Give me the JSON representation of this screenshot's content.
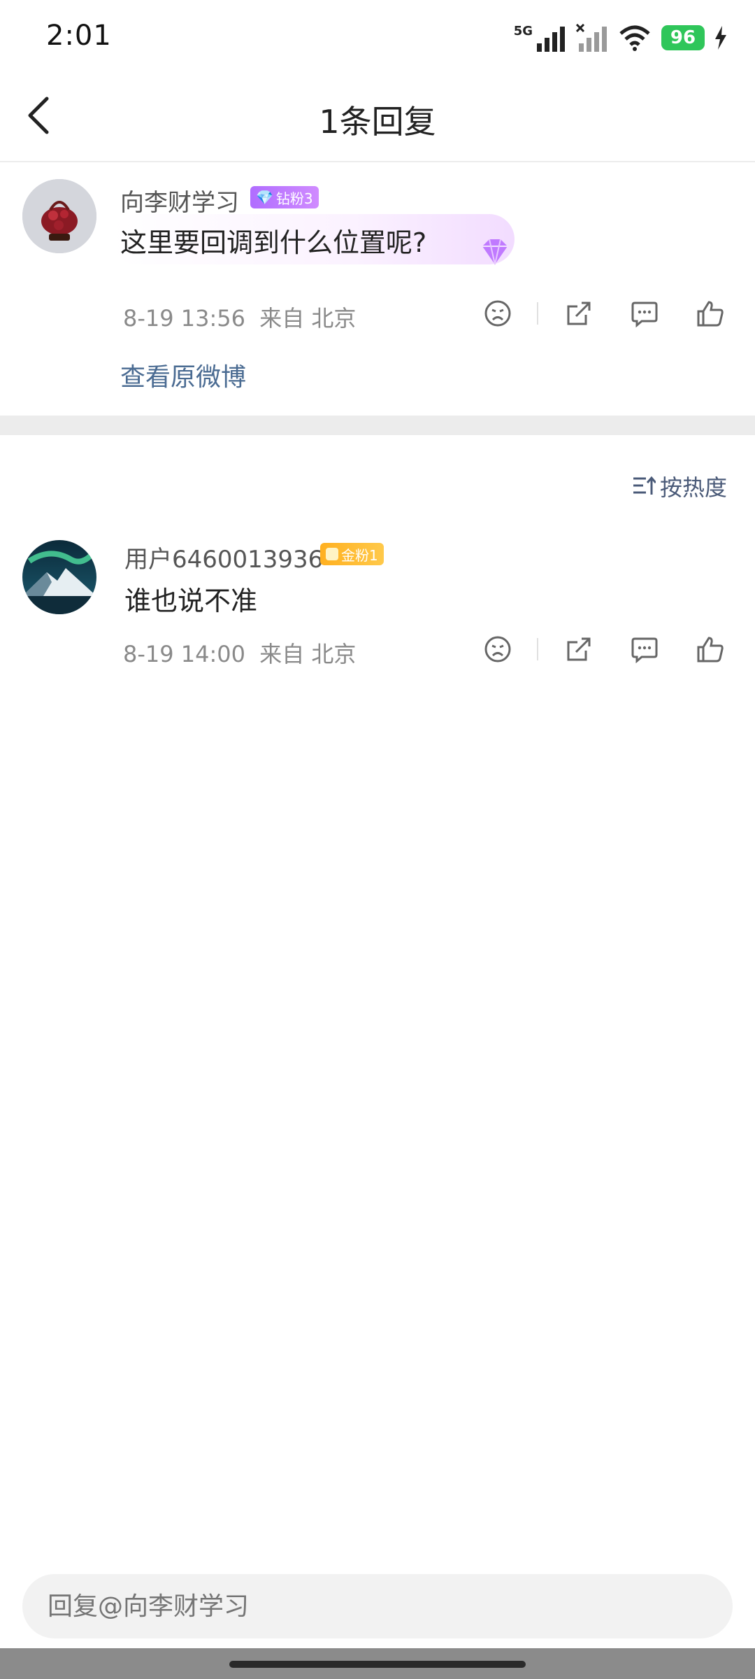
{
  "status_bar": {
    "time": "2:01",
    "network": "5G",
    "battery": "96"
  },
  "nav": {
    "title": "1条回复"
  },
  "main_comment": {
    "username": "向李财学习",
    "badge": "钻粉3",
    "text": "这里要回调到什么位置呢?",
    "date": "8-19 13:56",
    "location": "来自 北京",
    "view_link": "查看原微博"
  },
  "sort": {
    "label": "按热度"
  },
  "replies": [
    {
      "username": "用户6460013936",
      "badge": "金粉1",
      "text": "谁也说不准",
      "date": "8-19 14:00",
      "location": "来自 北京"
    }
  ],
  "reply_input": {
    "placeholder": "回复@向李财学习"
  },
  "colors": {
    "link": "#4a6b92",
    "battery": "#2fc65a",
    "badge_purple": "#b06dff",
    "badge_gold": "#ffb020"
  }
}
